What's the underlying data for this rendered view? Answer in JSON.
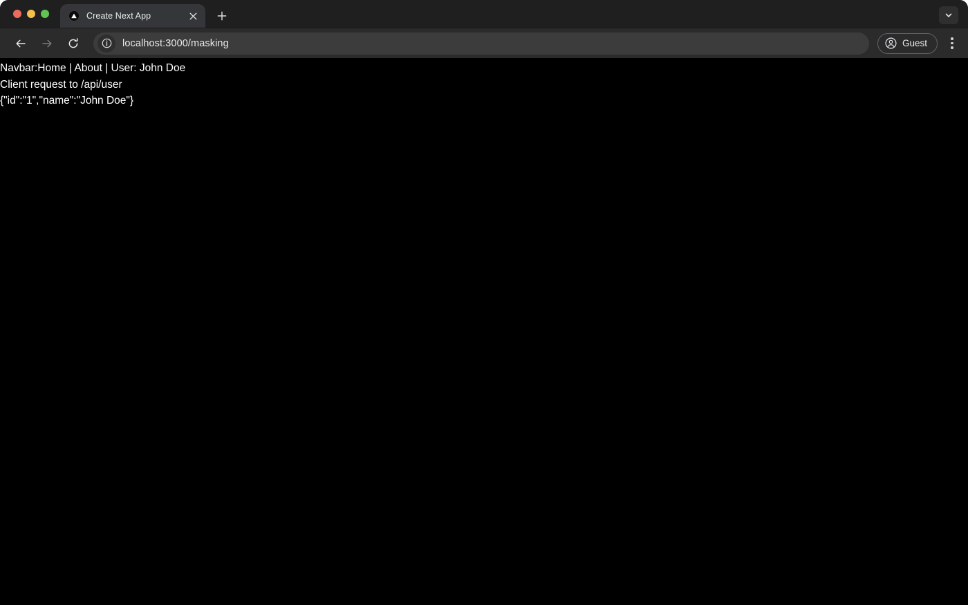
{
  "window": {
    "traffic_lights": [
      {
        "name": "close",
        "color": "#ed6a5e"
      },
      {
        "name": "minimize",
        "color": "#f4bf4f"
      },
      {
        "name": "maximize",
        "color": "#61c554"
      }
    ]
  },
  "tabstrip": {
    "tabs": [
      {
        "title": "Create Next App",
        "favicon": "nextjs-triangle-icon",
        "active": true
      }
    ],
    "new_tab_label": "+",
    "tab_list_icon": "chevron-down-icon",
    "close_icon": "close-icon"
  },
  "toolbar": {
    "back_icon": "arrow-left-icon",
    "forward_icon": "arrow-right-icon",
    "reload_icon": "reload-icon",
    "site_info_icon": "info-circle-icon",
    "url": "localhost:3000/masking",
    "url_placeholder": "Search Google or type a URL",
    "profile": {
      "label": "Guest",
      "icon": "account-circle-icon"
    },
    "menu_icon": "three-dot-menu-icon"
  },
  "page": {
    "background": "#000000",
    "text_color": "#ffffff",
    "lines": [
      "Navbar:Home | About | User: John Doe",
      "Client request to /api/user",
      "{\"id\":\"1\",\"name\":\"John Doe\"}"
    ]
  }
}
